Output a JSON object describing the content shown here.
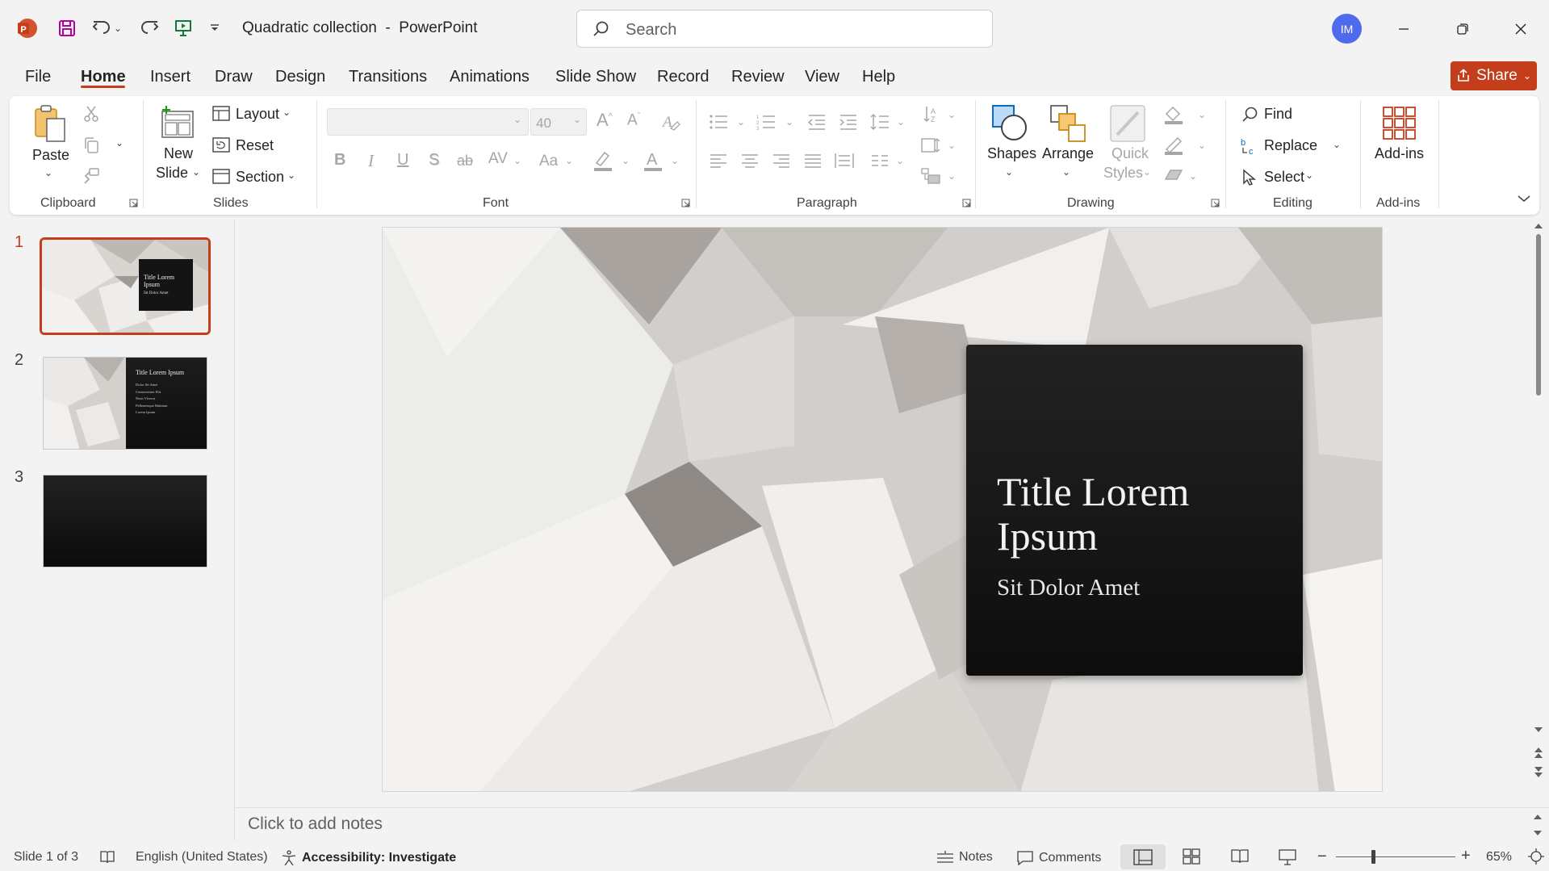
{
  "app": {
    "doc_title": "Quadratic collection  -  PowerPoint",
    "search_placeholder": "Search",
    "avatar_initials": "IM",
    "share_label": "Share",
    "accent": "#c43e1c"
  },
  "menu": {
    "tabs": [
      "File",
      "Home",
      "Insert",
      "Draw",
      "Design",
      "Transitions",
      "Animations",
      "Slide Show",
      "Record",
      "Review",
      "View",
      "Help"
    ],
    "active": "Home"
  },
  "ribbon": {
    "clipboard": {
      "group": "Clipboard",
      "paste": "Paste"
    },
    "slides": {
      "group": "Slides",
      "new_slide_1": "New",
      "new_slide_2": "Slide",
      "layout": "Layout",
      "reset": "Reset",
      "section": "Section"
    },
    "font": {
      "group": "Font",
      "font_name": "",
      "font_size": "40"
    },
    "paragraph": {
      "group": "Paragraph"
    },
    "drawing": {
      "group": "Drawing",
      "shapes": "Shapes",
      "arrange": "Arrange",
      "quick_styles_1": "Quick",
      "quick_styles_2": "Styles"
    },
    "editing": {
      "group": "Editing",
      "find": "Find",
      "replace": "Replace",
      "select": "Select"
    },
    "addins": {
      "group": "Add-ins",
      "addins": "Add-ins"
    }
  },
  "thumbnails": [
    {
      "num": "1",
      "title": "Title Lorem Ipsum",
      "subtitle": "Sit Dolor Amet"
    },
    {
      "num": "2",
      "title": "Title Lorem Ipsum",
      "bullets": [
        "Dolor Sit Amet",
        "Consectetuer Elit",
        "Nunc Viverra",
        "Pellentesque Habitant",
        "Lorem Ipsum"
      ]
    },
    {
      "num": "3"
    }
  ],
  "slide": {
    "title": "Title Lorem Ipsum",
    "subtitle": "Sit Dolor Amet"
  },
  "notes_placeholder": "Click to add notes",
  "status": {
    "slide_counter": "Slide 1 of 3",
    "language": "English (United States)",
    "accessibility": "Accessibility: Investigate",
    "notes": "Notes",
    "comments": "Comments",
    "zoom": "65%"
  }
}
